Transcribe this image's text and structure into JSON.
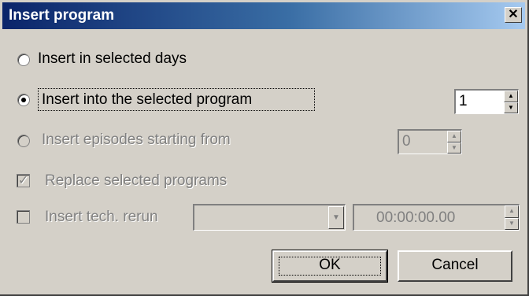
{
  "dialog": {
    "title": "Insert program",
    "close_glyph": "✕",
    "options": {
      "insert_selected_days": {
        "label": "Insert in selected days",
        "selected": false,
        "enabled": true
      },
      "insert_into_selected": {
        "label": "Insert into the selected program",
        "selected": true,
        "enabled": true
      },
      "insert_episodes_from": {
        "label": "Insert episodes starting from",
        "selected": false,
        "enabled": false
      }
    },
    "insert_count": {
      "value": "1"
    },
    "episode_start": {
      "value": "0"
    },
    "replace_selected": {
      "label": "Replace selected programs",
      "checked": true,
      "enabled": false
    },
    "insert_tech_rerun": {
      "label": "Insert tech. rerun",
      "checked": false,
      "enabled": false
    },
    "rerun_combo": {
      "value": ""
    },
    "rerun_time": {
      "value": "00:00:00.00"
    },
    "buttons": {
      "ok": "OK",
      "cancel": "Cancel"
    },
    "colors": {
      "title_start": "#0a246a",
      "title_end": "#a6caf0",
      "face": "#d4d0c8",
      "disabled_text": "#808080"
    }
  }
}
